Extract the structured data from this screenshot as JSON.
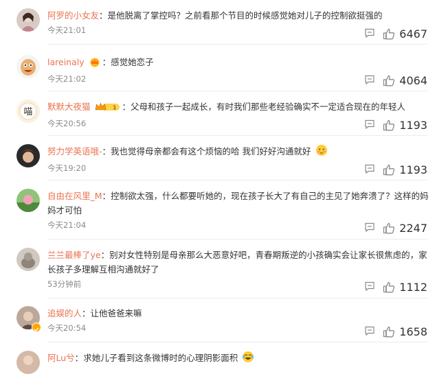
{
  "comments": [
    {
      "user": "阿罗的小女友",
      "sep": "：",
      "text": "是他脱离了掌控吗？之前看那个节目的时候感觉她对儿子的控制欲挺强的",
      "time": "今天21:01",
      "likes": "6467"
    },
    {
      "user": "lareinaly",
      "sep": "：",
      "text": "感觉她恋子",
      "time": "今天21:02",
      "likes": "4064"
    },
    {
      "user": "默默大夜猫",
      "sep": "：",
      "text": "父母和孩子一起成长，有时我们那些老经验确实不一定适合现在的年轻人",
      "time": "今天20:56",
      "likes": "1193",
      "badge": "1"
    },
    {
      "user": "努力学英语哦-",
      "sep": "：",
      "text": "我也觉得母亲都会有这个烦恼的哈 我们好好沟通就好",
      "time": "今天19:20",
      "likes": "1193"
    },
    {
      "user": "自由在风里_M",
      "sep": "：",
      "text": "控制欲太强，什么都要听她的，现在孩子长大了有自己的主见了她奔溃了？这样的妈妈才可怕",
      "time": "今天21:04",
      "likes": "2247"
    },
    {
      "user": "兰兰最棒了ye",
      "sep": "：",
      "text": "别对女性特别是母亲那么大恶意好吧，青春期叛逆的小孩确实会让家长很焦虑的，家长孩子多理解互相沟通就好了",
      "time": "53分钟前",
      "likes": "1112"
    },
    {
      "user": "追娱的人",
      "sep": "：",
      "text": "让他爸爸来嘛",
      "time": "今天20:54",
      "likes": "1658"
    },
    {
      "user": "阿Lu兮",
      "sep": "：",
      "text": "求她儿子看到这条微博时的心理阴影面积",
      "time": "",
      "likes": ""
    }
  ]
}
